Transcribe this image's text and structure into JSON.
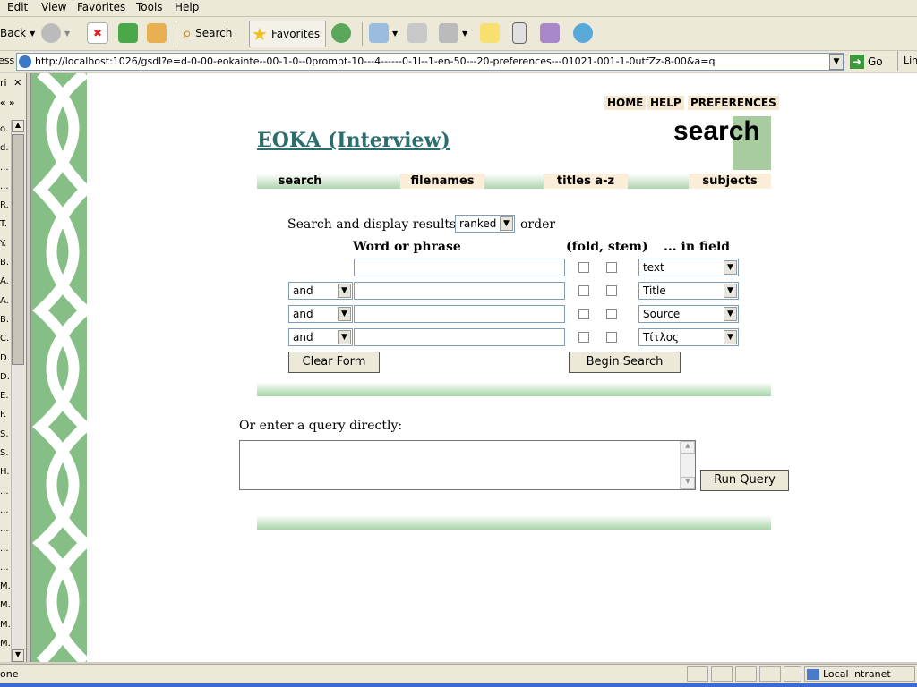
{
  "menu": [
    "Edit",
    "View",
    "Favorites",
    "Tools",
    "Help"
  ],
  "toolbar": {
    "back": "Back",
    "search": "Search",
    "favorites": "Favorites"
  },
  "address": {
    "label": "ess",
    "url": "http://localhost:1026/gsdl?e=d-0-00-eokainte--00-1-0--0prompt-10---4------0-1l--1-en-50---20-preferences---01021-001-1-0utfZz-8-00&a=q",
    "go": "Go",
    "links": "Lin"
  },
  "leftpane": {
    "tab": "ri",
    "chevrons": "«  »",
    "letters": [
      "o.",
      "d.",
      "...",
      "...",
      "R.",
      "T.",
      "Y.",
      "B.",
      "A.",
      "A.",
      "B.",
      "C.",
      "D.",
      "D.",
      "E.",
      "F.",
      "S.",
      "S.",
      "H.",
      "...",
      "...",
      "...",
      "...",
      "...",
      "M.",
      "M.",
      "M.",
      "M."
    ]
  },
  "page": {
    "topnav": [
      "HOME",
      "HELP",
      "PREFERENCES"
    ],
    "title": "EOKA (Interview)",
    "heading": "search",
    "navbar": [
      "search",
      "filenames",
      "titles a-z",
      "subjects"
    ],
    "form": {
      "display_prefix": "Search and display results in",
      "display_value": "ranked",
      "display_suffix": "order",
      "col_word": "Word or phrase",
      "col_fold": "(fold, stem)",
      "col_field": "... in field",
      "rows": [
        {
          "op": "",
          "field": "text"
        },
        {
          "op": "and",
          "field": "Title"
        },
        {
          "op": "and",
          "field": "Source"
        },
        {
          "op": "and",
          "field": "Τίτλος"
        }
      ],
      "clear": "Clear Form",
      "begin": "Begin Search"
    },
    "query_label": "Or enter a query directly:",
    "run": "Run Query"
  },
  "status": {
    "left": "one",
    "zone": "Local intranet"
  },
  "colors": {
    "green": "#6a9e6a",
    "title": "#2a6e6e",
    "tabbg": "#fbeed8"
  }
}
